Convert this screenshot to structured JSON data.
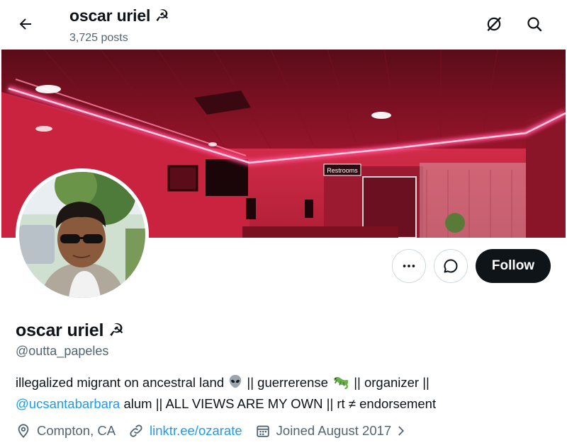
{
  "header": {
    "name": "oscar uriel ☭",
    "posts": "3,725 posts",
    "icons": [
      "back-arrow-icon",
      "grok-icon",
      "search-icon"
    ]
  },
  "actions": {
    "more_icon": "more-horizontal-icon",
    "message_icon": "message-icon",
    "follow_label": "Follow"
  },
  "profile": {
    "display_name": "oscar uriel ☭",
    "handle": "@outta_papeles",
    "bio_line1_a": "illegalized migrant on ancestral land",
    "bio_emoji1": "alien",
    "bio_line1_b": "|| guerrerense",
    "bio_emoji2": "lizard",
    "bio_line1_c": "|| organizer ||",
    "bio_mention": "@ucsantabarbara",
    "bio_line2": "alum || ALL VIEWS ARE MY OWN || rt ≠ endorsement",
    "location": "Compton, CA",
    "website": "linktr.ee/ozarate",
    "joined": "Joined August 2017"
  },
  "banner": {
    "sign_text": "Restrooms",
    "colors": {
      "neon": "#ff4d8d",
      "wall": "#c21f3a",
      "ceiling": "#6e0f1e"
    }
  },
  "colors": {
    "accent": "#1d9bf0",
    "text": "#0f1419",
    "muted": "#536471",
    "border": "#cfd9de"
  }
}
